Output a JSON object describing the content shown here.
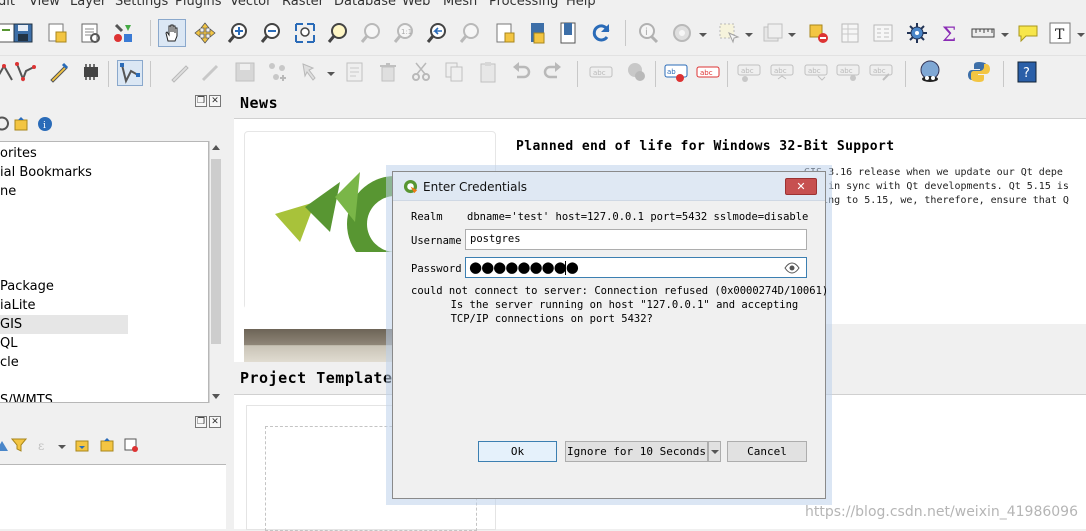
{
  "menu": [
    "dit",
    "View",
    "Layer",
    "Settings",
    "Plugins",
    "Vector",
    "Raster",
    "Database",
    "Web",
    "Mesh",
    "Processing",
    "Help"
  ],
  "browser": {
    "items": [
      "orites",
      "ial Bookmarks",
      "ne",
      "Package",
      "iaLite",
      "GIS",
      "QL",
      "cle",
      "S/WMTS"
    ]
  },
  "news": {
    "heading": "News",
    "headline": "Planned end of life for Windows 32-Bit Support",
    "body_lines": [
      "GIS 3.16 release when we update our Qt depe",
      "ing in sync with Qt developments. Qt 5.15 is",
      "lating to 5.15, we, therefore, ensure that Q"
    ]
  },
  "templates": {
    "heading": "Project Templates"
  },
  "dialog": {
    "title": "Enter Credentials",
    "close_label": "✕",
    "realm_label": "Realm",
    "realm_value": "dbname='test' host=127.0.0.1 port=5432 sslmode=disable",
    "username_label": "Username",
    "username_value": "postgres",
    "password_label": "Password",
    "password_value": "●●●●●●●●●",
    "error_lines": [
      "could not connect to server: Connection refused (0x0000274D/10061)",
      "        Is the server running on host \"127.0.0.1\" and accepting",
      "        TCP/IP connections on port 5432?"
    ],
    "ok_label": "Ok",
    "ignore_label": "Ignore for 10 Seconds",
    "cancel_label": "Cancel"
  },
  "watermark": "https://blog.csdn.net/weixin_41986096",
  "colors": {
    "qgis_green": "#589632",
    "qgis_orange": "#ee7913",
    "dialog_close": "#c75050",
    "focus_blue": "#3c7fb1"
  },
  "toolbar1_icons": [
    "new-project-icon",
    "save-project-icon",
    "save-as-icon",
    "print-layout-icon",
    "style-manager-icon",
    "pan-hand-icon",
    "pan-to-selection-icon",
    "zoom-in-icon",
    "zoom-out-icon",
    "zoom-full-icon",
    "zoom-selection-icon",
    "zoom-layer-icon",
    "zoom-native-icon",
    "zoom-last-icon",
    "zoom-next-icon",
    "new-bookmark-icon",
    "show-bookmarks-icon",
    "temporal-controller-icon",
    "refresh-icon",
    "identify-icon",
    "run-feature-action-icon",
    "select-features-icon",
    "deselect-icon",
    "open-attribute-table-icon",
    "field-calculator-icon",
    "toolbox-icon",
    "statistics-icon",
    "measure-icon",
    "map-tips-icon",
    "text-annotation-icon"
  ],
  "toolbar2_icons": [
    "add-vector-icon",
    "digitize-icon",
    "current-edits-icon",
    "gps-icon",
    "vertex-tool-icon",
    "toggle-editing-icon",
    "save-edits-icon",
    "add-feature-icon",
    "move-feature-icon",
    "delete-icon",
    "cut-icon",
    "copy-icon",
    "paste-icon",
    "undo-icon",
    "redo-icon",
    "label-toolbar-icon",
    "pin-labels-icon",
    "highlight-labels-icon",
    "show-hide-labels-icon",
    "move-label-icon",
    "rotate-label-icon",
    "change-label-icon",
    "python-console-icon",
    "help-icon"
  ]
}
